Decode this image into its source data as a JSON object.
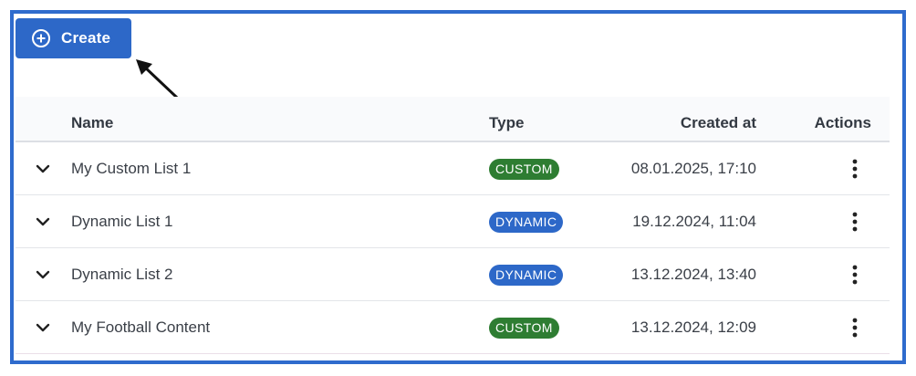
{
  "toolbar": {
    "create_label": "Create",
    "create_icon": "plus-circle-icon",
    "accent_color": "#2d68c8"
  },
  "table": {
    "headers": {
      "name": "Name",
      "type": "Type",
      "created_at": "Created at",
      "actions": "Actions"
    },
    "rows": [
      {
        "name": "My Custom List 1",
        "type": "CUSTOM",
        "type_color": "#2e7d32",
        "created_at": "08.01.2025, 17:10"
      },
      {
        "name": "Dynamic List 1",
        "type": "DYNAMIC",
        "type_color": "#2d68c8",
        "created_at": "19.12.2024, 11:04"
      },
      {
        "name": "Dynamic List 2",
        "type": "DYNAMIC",
        "type_color": "#2d68c8",
        "created_at": "13.12.2024, 13:40"
      },
      {
        "name": "My Football Content",
        "type": "CUSTOM",
        "type_color": "#2e7d32",
        "created_at": "13.12.2024, 12:09"
      }
    ]
  },
  "frame_color": "#2f6bcd"
}
